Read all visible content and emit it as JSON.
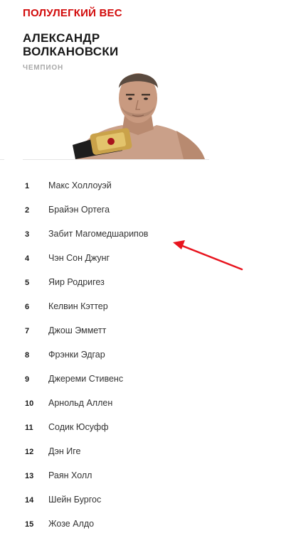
{
  "division": {
    "title": "ПОЛУЛЕГКИЙ ВЕС",
    "champion_name": "АЛЕКСАНДР ВОЛКАНОВСКИ",
    "champion_label": "ЧЕМПИОН"
  },
  "rankings": [
    {
      "rank": "1",
      "name": "Макс Холлоуэй"
    },
    {
      "rank": "2",
      "name": "Брайэн Ортега"
    },
    {
      "rank": "3",
      "name": "Забит Магомедшарипов"
    },
    {
      "rank": "4",
      "name": "Чэн Сон Джунг"
    },
    {
      "rank": "5",
      "name": "Яир Родригез"
    },
    {
      "rank": "6",
      "name": "Келвин Кэттер"
    },
    {
      "rank": "7",
      "name": "Джош Эмметт"
    },
    {
      "rank": "8",
      "name": "Фрэнки Эдгар"
    },
    {
      "rank": "9",
      "name": "Джереми Стивенс"
    },
    {
      "rank": "10",
      "name": "Арнольд Аллен"
    },
    {
      "rank": "11",
      "name": "Содик Юсуфф"
    },
    {
      "rank": "12",
      "name": "Дэн Иге"
    },
    {
      "rank": "13",
      "name": "Раян Холл"
    },
    {
      "rank": "14",
      "name": "Шейн Бургос"
    },
    {
      "rank": "15",
      "name": "Жозе Алдо"
    }
  ],
  "colors": {
    "accent": "#d20a0a",
    "annotation_arrow": "#e8141e"
  },
  "icons": {
    "annotation": "red-arrow-icon"
  }
}
